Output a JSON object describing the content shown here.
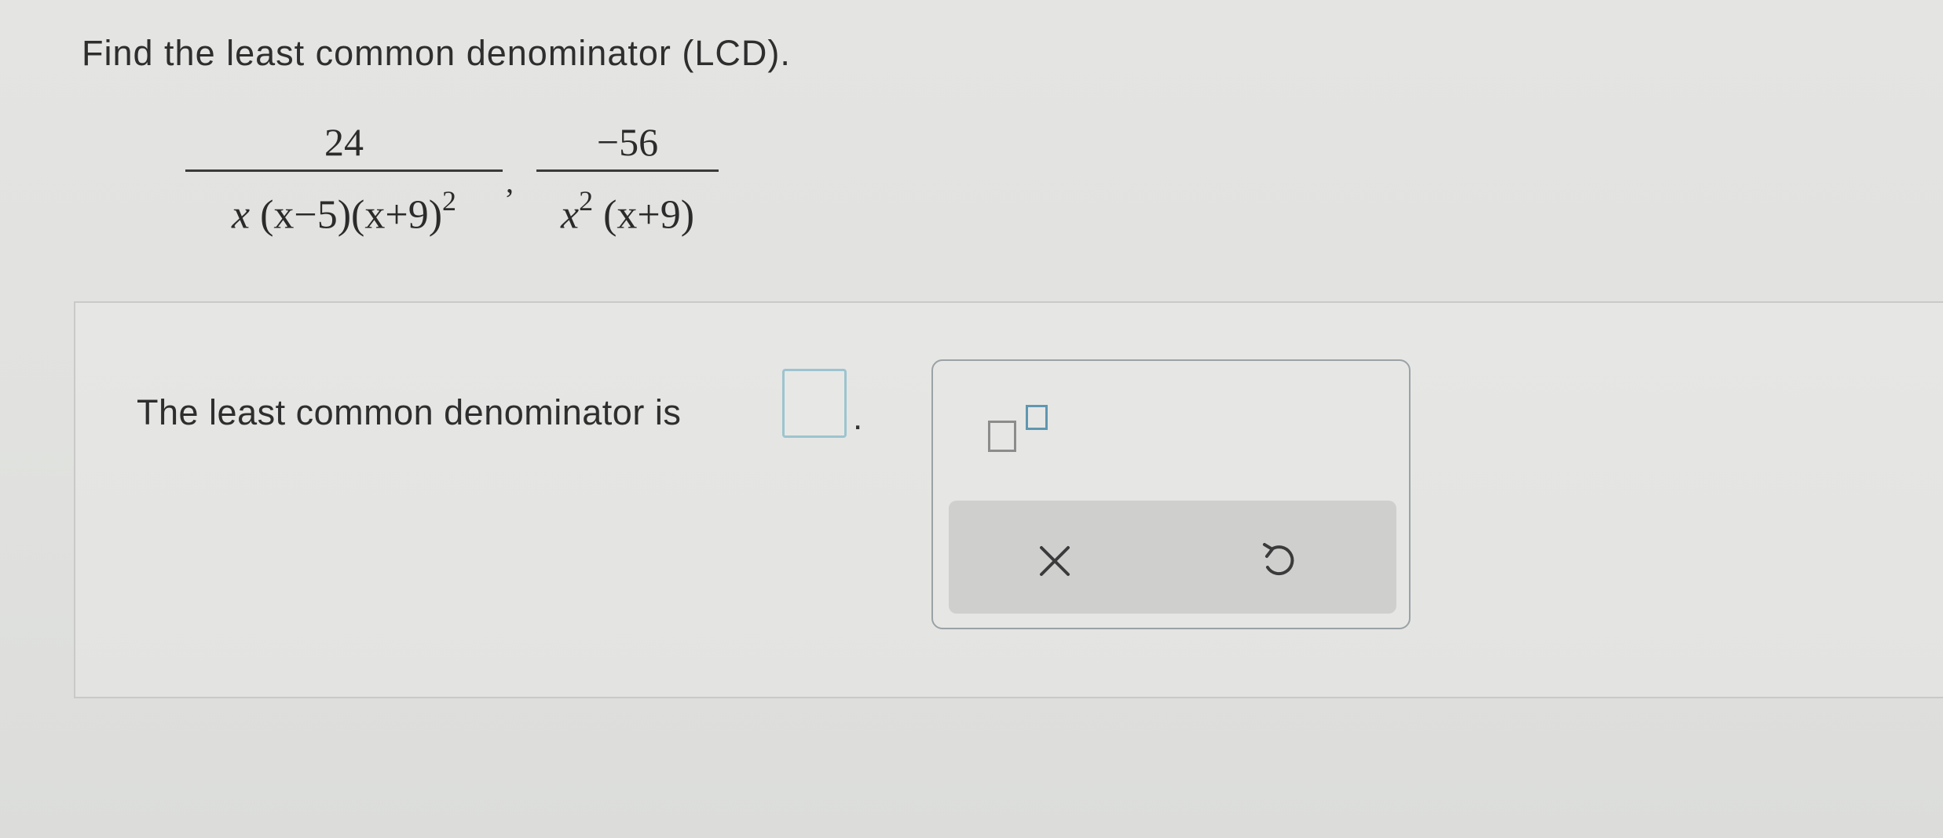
{
  "question": {
    "title": "Find the least common denominator (LCD)."
  },
  "expression": {
    "fraction1": {
      "numerator": "24",
      "denominator_parts": [
        "x",
        "(x−5)",
        "(x+9)",
        "2"
      ]
    },
    "separator": ",",
    "fraction2": {
      "numerator": "−56",
      "denominator_parts": [
        "x",
        "2",
        "(x+9)"
      ]
    }
  },
  "answer": {
    "label": "The least common denominator is",
    "input_value": "",
    "period": "."
  },
  "palette": {
    "buttons": [
      "exponent-template",
      "clear",
      "undo"
    ],
    "clear_symbol": "×",
    "undo_symbol": "↺"
  },
  "colors": {
    "background": "#e2e3e0",
    "input_border": "#9cc4cf",
    "palette_border": "#9aa2a6",
    "exponent_box": "#5f97b0",
    "action_bar": "#cfd0ce"
  }
}
